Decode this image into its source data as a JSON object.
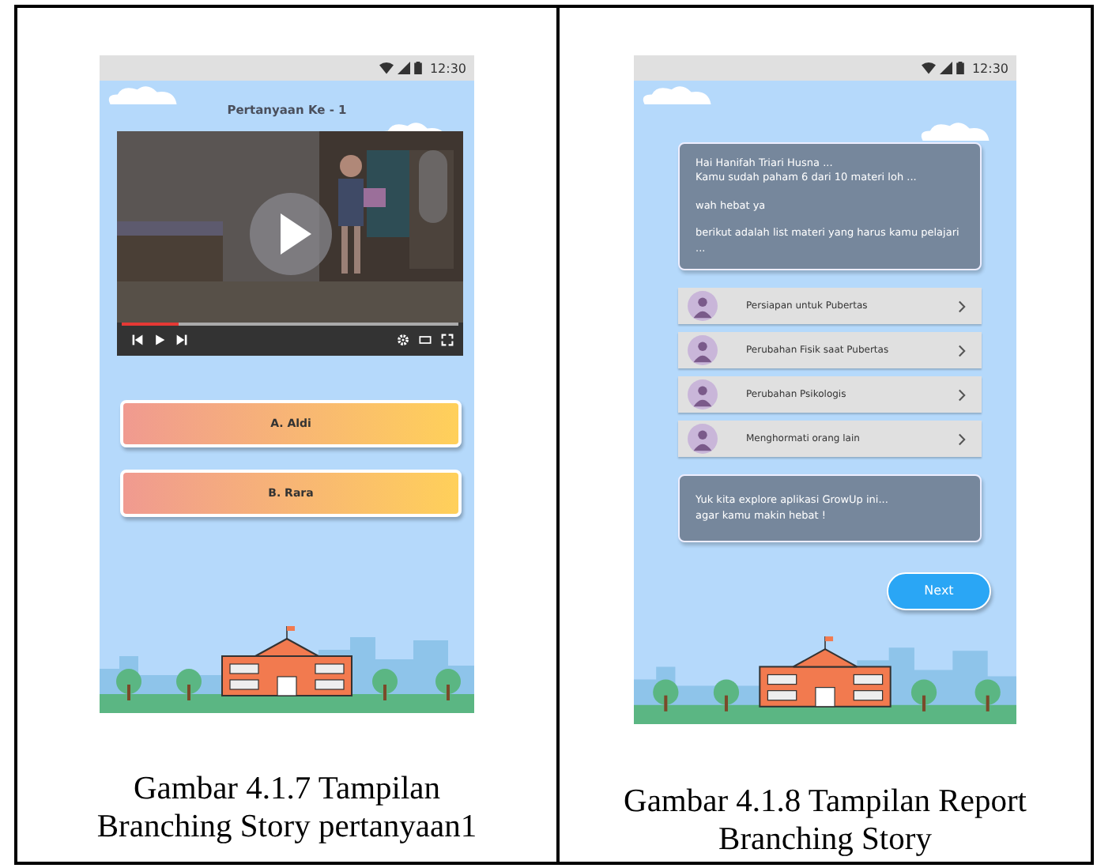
{
  "screens": [
    {
      "kind": "question",
      "status_time": "12:30",
      "title": "Pertanyaan Ke - 1",
      "video": {
        "level": 0.17
      },
      "answers": [
        "A. Aldi",
        "B. Rara"
      ]
    },
    {
      "kind": "report",
      "status_time": "12:30",
      "message": [
        "Hai Hanifah Triari Husna ...\nKamu sudah paham 6 dari 10 materi loh ...",
        "wah hebat ya",
        "berikut adalah list materi yang  harus kamu pelajari ..."
      ],
      "materials": [
        "Persiapan untuk Pubertas",
        "Perubahan Fisik saat Pubertas",
        "Perubahan Psikologis",
        "Menghormati orang lain"
      ],
      "closing": "Yuk kita explore aplikasi GrowUp ini...\nagar kamu makin hebat !",
      "next_button": "Next"
    }
  ],
  "captions": [
    "Gambar 4.1.7 Tampilan\nBranching Story pertanyaan1",
    "Gambar 4.1.8 Tampilan Report\nBranching Story"
  ]
}
